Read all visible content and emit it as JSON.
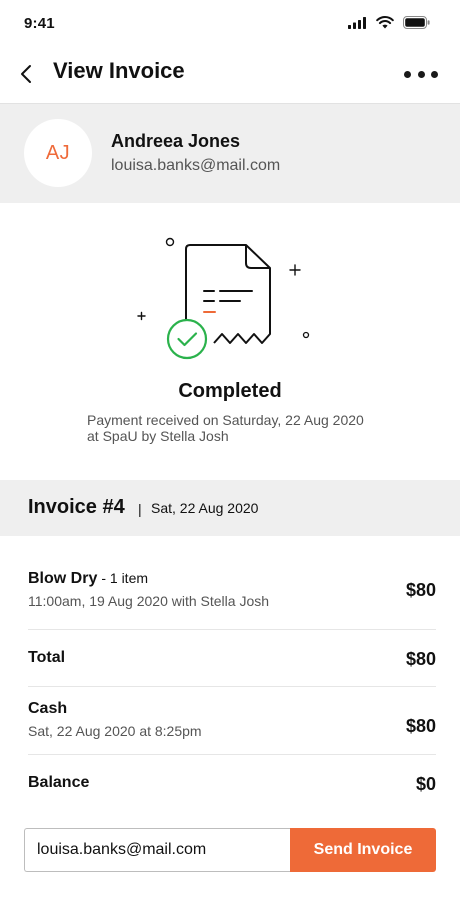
{
  "status_bar": {
    "time": "9:41"
  },
  "header": {
    "title": "View Invoice"
  },
  "customer": {
    "initials": "AJ",
    "name": "Andreea Jones",
    "email": "louisa.banks@mail.com"
  },
  "payment_status": {
    "title": "Completed",
    "line1": "Payment received on Saturday, 22 Aug 2020",
    "line2": "at SpaU by Stella Josh"
  },
  "invoice": {
    "number": "Invoice #4",
    "separator": "|",
    "date": "Sat, 22 Aug 2020"
  },
  "line_items": [
    {
      "name": "Blow Dry",
      "qty": "- 1 item",
      "detail": "11:00am, 19 Aug 2020 with Stella Josh",
      "amount": "$80"
    }
  ],
  "summary": {
    "total_label": "Total",
    "total_amount": "$80",
    "payment_label": "Cash",
    "payment_detail": "Sat, 22 Aug 2020 at 8:25pm",
    "payment_amount": "$80",
    "balance_label": "Balance",
    "balance_amount": "$0"
  },
  "send_form": {
    "email_value": "louisa.banks@mail.com",
    "button_label": "Send Invoice"
  },
  "colors": {
    "accent": "#ee6a38",
    "success": "#2bb24c",
    "panel": "#efefef"
  },
  "icons": [
    "signal-icon",
    "wifi-icon",
    "battery-icon",
    "back-arrow-icon",
    "more-icon",
    "receipt-illustration",
    "check-circle-icon"
  ]
}
